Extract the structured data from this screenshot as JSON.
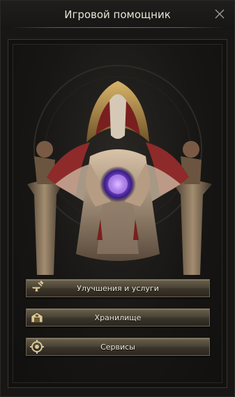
{
  "window": {
    "title": "Игровой помощник"
  },
  "menu": {
    "items": [
      {
        "label": "Улучшения и услуги",
        "icon": "anvil-icon"
      },
      {
        "label": "Хранилище",
        "icon": "storage-chest-icon"
      },
      {
        "label": "Сервисы",
        "icon": "services-gear-icon"
      }
    ]
  },
  "colors": {
    "accent_gold": "#8a7447",
    "button_top": "#6a614d",
    "button_bottom": "#2b2620",
    "background": "#181716"
  }
}
